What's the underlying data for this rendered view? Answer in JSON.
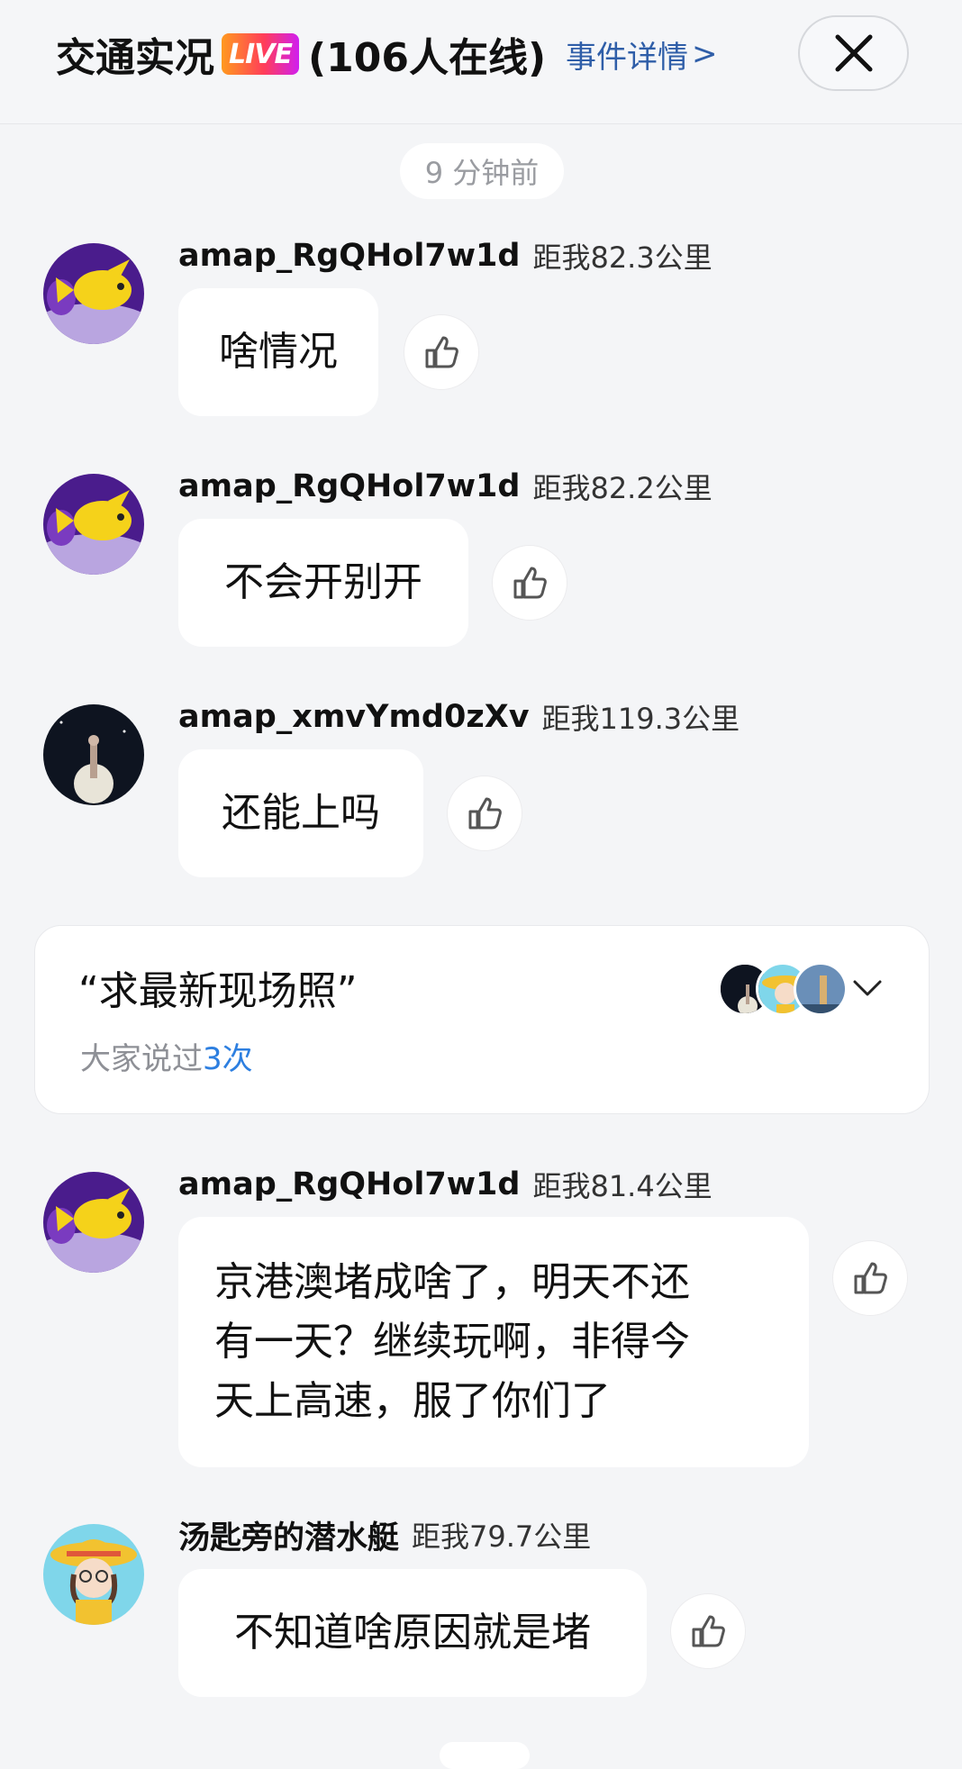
{
  "header": {
    "title": "交通实况",
    "live_badge": "LIVE",
    "online": "(106人在线)",
    "event_link": "事件详情",
    "event_link_chevron": ">",
    "close_icon": "close-icon"
  },
  "time_divider": "9 分钟前",
  "messages": [
    {
      "username": "amap_RgQHol7w1d",
      "distance": "距我82.3公里",
      "text": "啥情况",
      "avatar": "yellow-fish-avatar"
    },
    {
      "username": "amap_RgQHol7w1d",
      "distance": "距我82.2公里",
      "text": "不会开别开",
      "avatar": "yellow-fish-avatar"
    },
    {
      "username": "amap_xmvYmd0zXv",
      "distance": "距我119.3公里",
      "text": "还能上吗",
      "avatar": "night-moon-avatar"
    },
    {
      "username": "amap_RgQHol7w1d",
      "distance": "距我81.4公里",
      "text_lines": [
        "京港澳堵成啥了，明天不还",
        "有一天？继续玩啊，非得今",
        "天上高速，服了你们了"
      ],
      "avatar": "yellow-fish-avatar"
    },
    {
      "username": "汤匙旁的潜水艇",
      "distance": "距我79.7公里",
      "text": "不知道啥原因就是堵",
      "avatar": "cartoon-girl-avatar"
    }
  ],
  "summary_card": {
    "quote": "“求最新现场照”",
    "said_prefix": "大家说过",
    "said_count": "3次",
    "expand_icon": "chevron-down-icon"
  },
  "colors": {
    "background": "#f4f5f7",
    "bubble": "#ffffff",
    "link": "#2f5ea8",
    "count_accent": "#2d7fe0"
  }
}
